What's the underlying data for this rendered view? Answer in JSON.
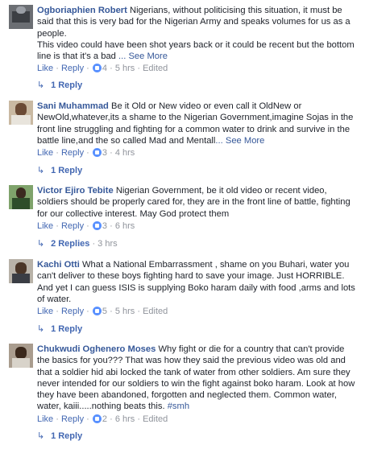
{
  "comments": [
    {
      "author": "Ogboriaphien Robert",
      "body": "Nigerians, without politicising this situation, it must be said that this is very bad for the Nigerian Army and speaks volumes for us as a people.",
      "body2": "This video could have been shot years back or it could be recent but the bottom line is that it's a bad",
      "see_more": "... See More",
      "like": "Like",
      "reply": "Reply",
      "reaction_count": "4",
      "time": "5 hrs",
      "edited": "Edited",
      "replies": "1 Reply",
      "replies_time": ""
    },
    {
      "author": "Sani Muhammad",
      "body": "Be it Old or New video or even call it OldNew or NewOld,whatever,its a shame to the Nigerian Government,imagine Sojas in the front line struggling and fighting for a common water to drink and survive in the battle line,and the so called Mad and Mentall",
      "see_more": "... See More",
      "like": "Like",
      "reply": "Reply",
      "reaction_count": "3",
      "time": "4 hrs",
      "edited": "",
      "replies": "1 Reply",
      "replies_time": ""
    },
    {
      "author": "Victor Ejiro Tebite",
      "body": "Nigerian Government, be it old video or recent video, soldiers should be properly cared for, they are in the front line of battle, fighting for our collective interest. May God protect them",
      "see_more": "",
      "like": "Like",
      "reply": "Reply",
      "reaction_count": "3",
      "time": "6 hrs",
      "edited": "",
      "replies": "2 Replies",
      "replies_time": "3 hrs"
    },
    {
      "author": "Kachi Otti",
      "body": "What a National Embarrassment , shame on you Buhari, water you can't deliver to these boys fighting hard to save your image. Just HORRIBLE. And yet I can guess ISIS is supplying Boko haram daily with food ,arms and lots of water.",
      "see_more": "",
      "like": "Like",
      "reply": "Reply",
      "reaction_count": "5",
      "time": "5 hrs",
      "edited": "Edited",
      "replies": "1 Reply",
      "replies_time": ""
    },
    {
      "author": "Chukwudi Oghenero Moses",
      "body": "Why fight or die for a country that can't provide the basics for you??? That was how they said the previous video was old and that a soldier hid abi locked the tank of water from other soldiers. Am sure they never intended for our soldiers to win the fight against boko haram. Look at how they have been abandoned, forgotten and neglected them. Common water, water, kaiii.....nothing beats this.",
      "hashtag": "#smh",
      "see_more": "",
      "like": "Like",
      "reply": "Reply",
      "reaction_count": "2",
      "time": "6 hrs",
      "edited": "Edited",
      "replies": "1 Reply",
      "replies_time": ""
    }
  ],
  "separator": "·",
  "reply_arrow": "↳",
  "colors": {
    "link": "#365899",
    "meta": "#90949c",
    "reaction": "#5890ff"
  },
  "icons": {
    "reaction": "like-reaction-icon",
    "reply_arrow": "reply-arrow-icon"
  }
}
